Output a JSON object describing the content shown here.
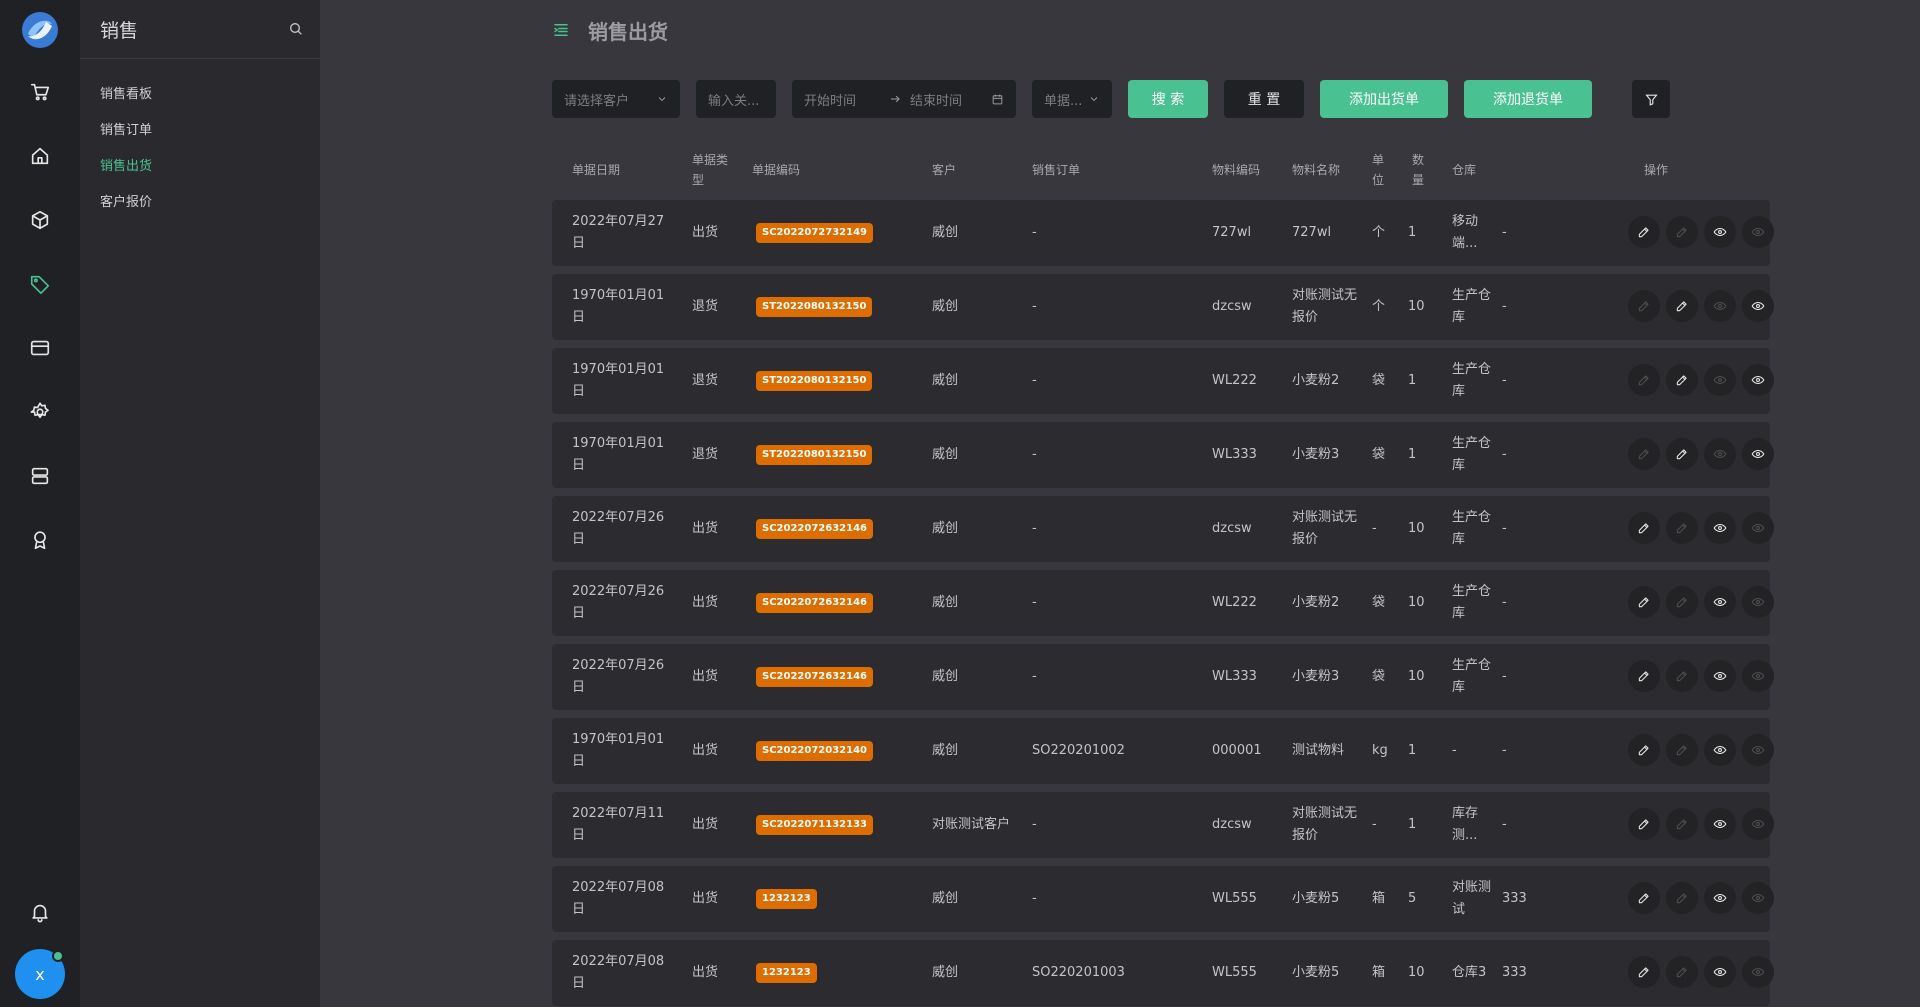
{
  "sidebar": {
    "title": "销售",
    "items": [
      {
        "label": "销售看板",
        "active": false
      },
      {
        "label": "销售订单",
        "active": false
      },
      {
        "label": "销售出货",
        "active": true
      },
      {
        "label": "客户报价",
        "active": false
      }
    ],
    "avatar_letter": "x"
  },
  "page": {
    "title": "销售出货"
  },
  "filters": {
    "customer_placeholder": "请选择客户",
    "keyword_placeholder": "输入关...",
    "start_placeholder": "开始时间",
    "end_placeholder": "结束时间",
    "doc_type_placeholder": "单据...",
    "search_label": "搜 索",
    "reset_label": "重 置",
    "add_out_label": "添加出货单",
    "add_return_label": "添加退货单"
  },
  "table": {
    "headers": {
      "date": "单据日期",
      "type": "单据类型",
      "code": "单据编码",
      "customer": "客户",
      "order": "销售订单",
      "material_code": "物料编码",
      "material_name": "物料名称",
      "unit": "单位",
      "qty": "数量",
      "warehouse": "仓库",
      "extra": "",
      "actions": "操作"
    },
    "rows": [
      {
        "date": "2022年07月27日",
        "type": "出货",
        "code": "SC2022072732149",
        "customer": "威创",
        "order": "-",
        "material_code": "727wl",
        "material_name": "727wl",
        "unit": "个",
        "qty": "1",
        "warehouse": "移动端...",
        "extra": "-",
        "acts": [
          true,
          false,
          true,
          false
        ]
      },
      {
        "date": "1970年01月01日",
        "type": "退货",
        "code": "ST2022080132150",
        "customer": "威创",
        "order": "-",
        "material_code": "dzcsw",
        "material_name": "对账测试无报价",
        "unit": "个",
        "qty": "10",
        "warehouse": "生产仓库",
        "extra": "-",
        "acts": [
          false,
          true,
          false,
          true
        ]
      },
      {
        "date": "1970年01月01日",
        "type": "退货",
        "code": "ST2022080132150",
        "customer": "威创",
        "order": "-",
        "material_code": "WL222",
        "material_name": "小麦粉2",
        "unit": "袋",
        "qty": "1",
        "warehouse": "生产仓库",
        "extra": "-",
        "acts": [
          false,
          true,
          false,
          true
        ]
      },
      {
        "date": "1970年01月01日",
        "type": "退货",
        "code": "ST2022080132150",
        "customer": "威创",
        "order": "-",
        "material_code": "WL333",
        "material_name": "小麦粉3",
        "unit": "袋",
        "qty": "1",
        "warehouse": "生产仓库",
        "extra": "-",
        "acts": [
          false,
          true,
          false,
          true
        ]
      },
      {
        "date": "2022年07月26日",
        "type": "出货",
        "code": "SC2022072632146",
        "customer": "威创",
        "order": "-",
        "material_code": "dzcsw",
        "material_name": "对账测试无报价",
        "unit": "-",
        "qty": "10",
        "warehouse": "生产仓库",
        "extra": "-",
        "acts": [
          true,
          false,
          true,
          false
        ]
      },
      {
        "date": "2022年07月26日",
        "type": "出货",
        "code": "SC2022072632146",
        "customer": "威创",
        "order": "-",
        "material_code": "WL222",
        "material_name": "小麦粉2",
        "unit": "袋",
        "qty": "10",
        "warehouse": "生产仓库",
        "extra": "-",
        "acts": [
          true,
          false,
          true,
          false
        ]
      },
      {
        "date": "2022年07月26日",
        "type": "出货",
        "code": "SC2022072632146",
        "customer": "威创",
        "order": "-",
        "material_code": "WL333",
        "material_name": "小麦粉3",
        "unit": "袋",
        "qty": "10",
        "warehouse": "生产仓库",
        "extra": "-",
        "acts": [
          true,
          false,
          true,
          false
        ]
      },
      {
        "date": "1970年01月01日",
        "type": "出货",
        "code": "SC2022072032140",
        "customer": "威创",
        "order": "SO220201002",
        "material_code": "000001",
        "material_name": "测试物料",
        "unit": "kg",
        "qty": "1",
        "warehouse": "-",
        "extra": "-",
        "acts": [
          true,
          false,
          true,
          false
        ]
      },
      {
        "date": "2022年07月11日",
        "type": "出货",
        "code": "SC2022071132133",
        "customer": "对账测试客户",
        "order": "-",
        "material_code": "dzcsw",
        "material_name": "对账测试无报价",
        "unit": "-",
        "qty": "1",
        "warehouse": "库存测...",
        "extra": "-",
        "acts": [
          true,
          false,
          true,
          false
        ]
      },
      {
        "date": "2022年07月08日",
        "type": "出货",
        "code": "1232123",
        "customer": "威创",
        "order": "-",
        "material_code": "WL555",
        "material_name": "小麦粉5",
        "unit": "箱",
        "qty": "5",
        "warehouse": "对账测试",
        "extra": "333",
        "acts": [
          true,
          false,
          true,
          false
        ]
      },
      {
        "date": "2022年07月08日",
        "type": "出货",
        "code": "1232123",
        "customer": "威创",
        "order": "SO220201003",
        "material_code": "WL555",
        "material_name": "小麦粉5",
        "unit": "箱",
        "qty": "10",
        "warehouse": "仓库3",
        "extra": "333",
        "acts": [
          true,
          false,
          true,
          false
        ]
      }
    ]
  }
}
